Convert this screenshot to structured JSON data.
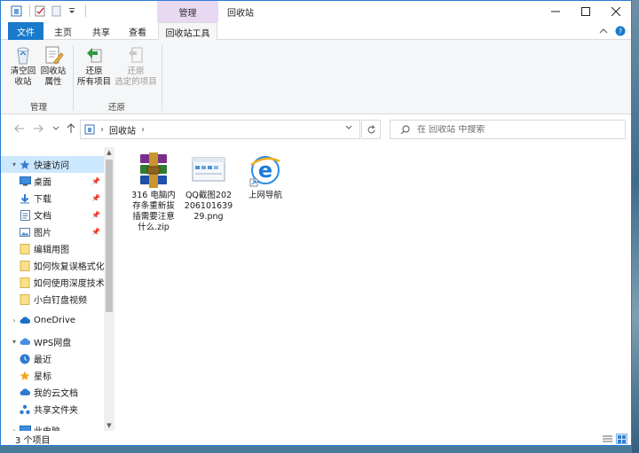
{
  "titlebar": {
    "context_tab": "管理",
    "title": "回收站"
  },
  "ribbon_tabs": {
    "file": "文件",
    "home": "主页",
    "share": "共享",
    "view": "查看",
    "tools": "回收站工具"
  },
  "ribbon": {
    "empty_label_1": "清空回",
    "empty_label_2": "收站",
    "props_label_1": "回收站",
    "props_label_2": "属性",
    "restore_all_1": "还原",
    "restore_all_2": "所有项目",
    "restore_sel_1": "还原",
    "restore_sel_2": "选定的项目",
    "group_manage": "管理",
    "group_restore": "还原"
  },
  "address": {
    "crumb": "回收站"
  },
  "search": {
    "placeholder": "在 回收站 中搜索"
  },
  "nav": {
    "quick_access": "快速访问",
    "desktop": "桌面",
    "downloads": "下载",
    "documents": "文档",
    "pictures": "图片",
    "folder1": "编辑用图",
    "folder2": "如何恢复误格式化",
    "folder3": "如何使用深度技术",
    "folder4": "小白钉盘视频",
    "onedrive": "OneDrive",
    "wps": "WPS网盘",
    "recent": "最近",
    "starred": "星标",
    "mycloud": "我的云文档",
    "shared": "共享文件夹",
    "thispc": "此电脑"
  },
  "files": [
    {
      "name": "316 电脑内存条重新拔插需要注意什么.zip",
      "icon": "winrar-archive-icon"
    },
    {
      "name": "QQ截图20220610163929.png",
      "icon": "image-file-icon"
    },
    {
      "name": "上网导航",
      "icon": "ie-shortcut-icon"
    }
  ],
  "status": {
    "count": "3 个项目"
  },
  "colors": {
    "accent": "#1979ca",
    "context_tab": "#e8d8f2",
    "selected": "#cce8ff"
  }
}
